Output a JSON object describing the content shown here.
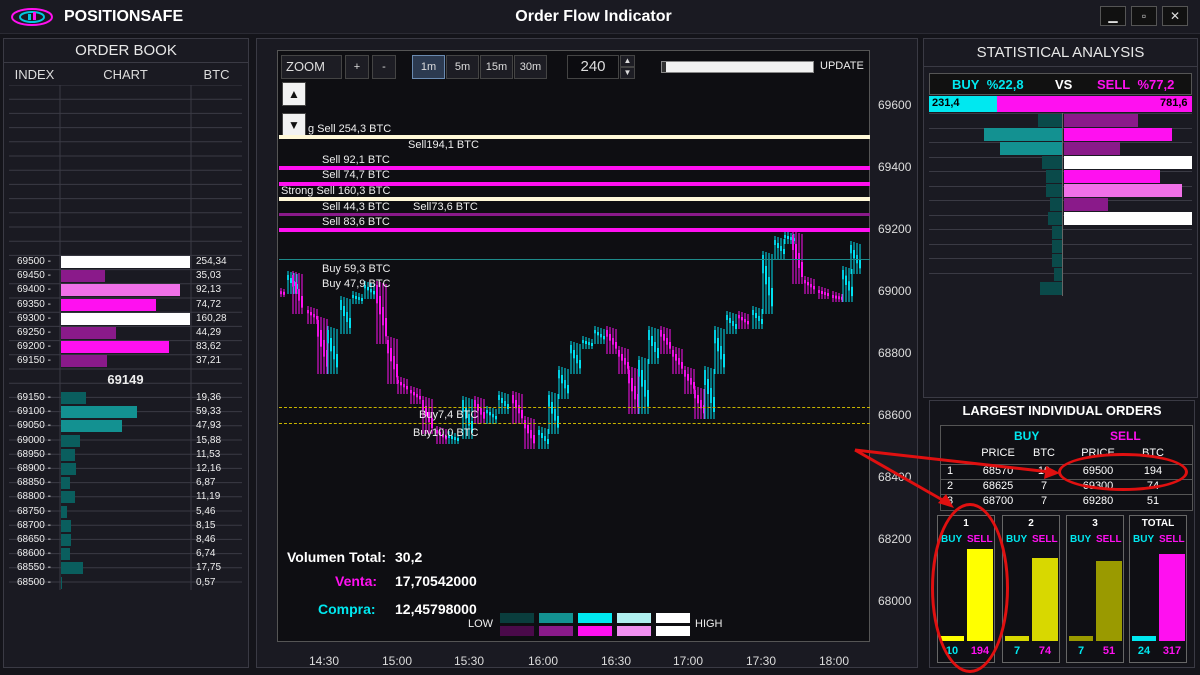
{
  "app": {
    "name": "POSITIONSAFE",
    "window_title": "Order Flow Indicator",
    "controls": [
      "▁",
      "▫",
      "✕"
    ]
  },
  "order_book": {
    "title": "ORDER BOOK",
    "columns": [
      "INDEX",
      "CHART",
      "BTC"
    ],
    "sell_rows": [
      {
        "index": "69500 -",
        "btc": "254,34",
        "color": "#ffffff",
        "fraction": 1.0
      },
      {
        "index": "69450 -",
        "btc": "35,03",
        "color": "#8a1a8a",
        "fraction": 0.34
      },
      {
        "index": "69400 -",
        "btc": "92,13",
        "color": "#f070e8",
        "fraction": 0.92
      },
      {
        "index": "69350 -",
        "btc": "74,72",
        "color": "#ff10f0",
        "fraction": 0.74
      },
      {
        "index": "69300 -",
        "btc": "160,28",
        "color": "#ffffff",
        "fraction": 1.0
      },
      {
        "index": "69250 -",
        "btc": "44,29",
        "color": "#8a1a8a",
        "fraction": 0.43
      },
      {
        "index": "69200 -",
        "btc": "83,62",
        "color": "#ff10f0",
        "fraction": 0.84
      },
      {
        "index": "69150 -",
        "btc": "37,21",
        "color": "#8a1a8a",
        "fraction": 0.36
      }
    ],
    "mid_price": "69149",
    "buy_rows": [
      {
        "index": "69150 -",
        "btc": "19,36",
        "color": "#0a5e5e",
        "fraction": 0.19
      },
      {
        "index": "69100 -",
        "btc": "59,33",
        "color": "#139191",
        "fraction": 0.59
      },
      {
        "index": "69050 -",
        "btc": "47,93",
        "color": "#139191",
        "fraction": 0.47
      },
      {
        "index": "69000 -",
        "btc": "15,88",
        "color": "#0a5e5e",
        "fraction": 0.15
      },
      {
        "index": "68950 -",
        "btc": "11,53",
        "color": "#0a5e5e",
        "fraction": 0.11
      },
      {
        "index": "68900 -",
        "btc": "12,16",
        "color": "#0a5e5e",
        "fraction": 0.12
      },
      {
        "index": "68850 -",
        "btc": "6,87",
        "color": "#0a5e5e",
        "fraction": 0.07
      },
      {
        "index": "68800 -",
        "btc": "11,19",
        "color": "#0a5e5e",
        "fraction": 0.11
      },
      {
        "index": "68750 -",
        "btc": "5,46",
        "color": "#0a5e5e",
        "fraction": 0.05
      },
      {
        "index": "68700 -",
        "btc": "8,15",
        "color": "#0a5e5e",
        "fraction": 0.08
      },
      {
        "index": "68650 -",
        "btc": "8,46",
        "color": "#0a5e5e",
        "fraction": 0.08
      },
      {
        "index": "68600 -",
        "btc": "6,74",
        "color": "#0a5e5e",
        "fraction": 0.07
      },
      {
        "index": "68550 -",
        "btc": "17,75",
        "color": "#0a5e5e",
        "fraction": 0.17
      },
      {
        "index": "68500 -",
        "btc": "0,57",
        "color": "#0a5e5e",
        "fraction": 0.01
      }
    ]
  },
  "chart": {
    "zoom_label": "ZOOM",
    "zoom_in": "+",
    "zoom_out": "-",
    "timeframes": [
      "1m",
      "5m",
      "15m",
      "30m"
    ],
    "active_timeframe": "1m",
    "count_value": "240",
    "update_label": "UPDATE",
    "scroll_up": "▲",
    "scroll_down": "▼",
    "y_ticks": [
      "69600",
      "69400",
      "69200",
      "69000",
      "68800",
      "68600",
      "68400",
      "68200",
      "68000"
    ],
    "x_ticks": [
      "14:30",
      "15:00",
      "15:30",
      "16:00",
      "16:30",
      "17:00",
      "17:30",
      "18:00"
    ],
    "levels": [
      {
        "price": 69500,
        "label": "g Sell 254,3 BTC",
        "color": "#fff8d8"
      },
      {
        "price": 69400,
        "label": "Sell 92,1 BTC",
        "color": "#ff10f0"
      },
      {
        "price": 69350,
        "label": "Sell 74,7 BTC",
        "color": "#ff10f0"
      },
      {
        "price": 69300,
        "label": "Strong Sell 160,3 BTC",
        "color": "#fff8d8"
      },
      {
        "price": 69250,
        "label": "Sell 44,3 BTC",
        "color": "#8a1a8a"
      },
      {
        "price": 69200,
        "label": "Sell 83,6 BTC",
        "color": "#ff10f0"
      }
    ],
    "side_labels": [
      "Sell194,1 BTC",
      "Sell73,6 BTC",
      "Buy 59,3 BTC",
      "Buy 47,9 BTC",
      "Buy7,4 BTC",
      "Buy10,0 BTC"
    ],
    "volume_total_label": "Volumen Total:",
    "volume_total": "30,2",
    "venta_label": "Venta:",
    "venta": "17,70542000",
    "compra_label": "Compra:",
    "compra": "12,45798000",
    "low_label": "LOW",
    "high_label": "HIGH",
    "legend_buy_colors": [
      "#0a3d3d",
      "#139191",
      "#00e8f0",
      "#b0f0f0",
      "#ffffff"
    ],
    "legend_sell_colors": [
      "#4a0a4a",
      "#8a1a8a",
      "#ff10f0",
      "#f090f0",
      "#ffffff"
    ],
    "accent_cyan": "#00e8f0",
    "accent_magenta": "#ff10f0"
  },
  "stats": {
    "title": "STATISTICAL ANALYSIS",
    "buy_label": "BUY",
    "buy_pct": "%22,8",
    "vs": "VS",
    "sell_label": "SELL",
    "sell_pct": "%77,2",
    "buy_total": "231,4",
    "sell_total": "781,6",
    "buy_fraction": 0.228,
    "largest_title": "LARGEST INDIVIDUAL ORDERS",
    "buy_head": "BUY",
    "sell_head": "SELL",
    "price_head": "PRICE",
    "btc_head": "BTC",
    "orders": [
      {
        "rank": "1",
        "buy_price": "68570",
        "buy_btc": "10",
        "sell_price": "69500",
        "sell_btc": "194"
      },
      {
        "rank": "2",
        "buy_price": "68625",
        "buy_btc": "7",
        "sell_price": "69300",
        "sell_btc": "74"
      },
      {
        "rank": "3",
        "buy_price": "68700",
        "buy_btc": "7",
        "sell_price": "69280",
        "sell_btc": "51"
      }
    ],
    "boxes": [
      {
        "title": "1",
        "buy": "10",
        "sell": "194",
        "buy_color": "#ffff00",
        "sell_color": "#ffff00",
        "sell_fraction": 0.97
      },
      {
        "title": "2",
        "buy": "7",
        "sell": "74",
        "buy_color": "#d8d800",
        "sell_color": "#d8d800",
        "sell_fraction": 0.87
      },
      {
        "title": "3",
        "buy": "7",
        "sell": "51",
        "buy_color": "#9a9a00",
        "sell_color": "#9a9a00",
        "sell_fraction": 0.84
      },
      {
        "title": "TOTAL",
        "buy": "24",
        "sell": "317",
        "buy_color": "#00e8f0",
        "sell_color": "#ff10f0",
        "sell_fraction": 0.92
      }
    ],
    "buy_lbl": "BUY",
    "sell_lbl": "SELL"
  }
}
